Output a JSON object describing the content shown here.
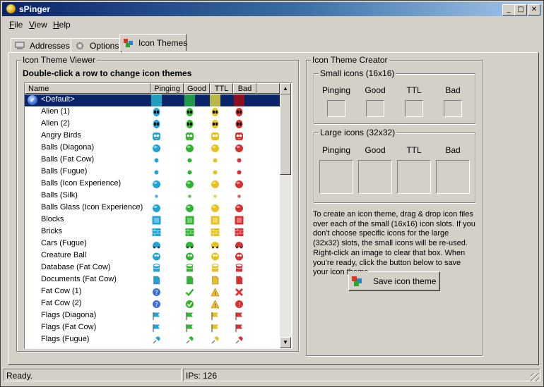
{
  "window": {
    "title": "sPinger"
  },
  "menu": [
    {
      "label": "File",
      "key": "F",
      "rest": "ile"
    },
    {
      "label": "View",
      "key": "V",
      "rest": "iew"
    },
    {
      "label": "Help",
      "key": "H",
      "rest": "elp"
    }
  ],
  "tabs": [
    {
      "label": "Addresses",
      "active": false
    },
    {
      "label": "Options",
      "active": false
    },
    {
      "label": "Icon Themes",
      "active": true
    }
  ],
  "viewer": {
    "group_title": "Icon Theme Viewer",
    "instruction": "Double-click a row to change icon themes",
    "columns": [
      "Name",
      "Pinging",
      "Good",
      "TTL",
      "Bad"
    ],
    "rows": [
      {
        "name": "<Default>",
        "selected": true,
        "icon": "default-swatch"
      },
      {
        "name": "Alien (1)",
        "icon": "alien"
      },
      {
        "name": "Alien (2)",
        "icon": "alien"
      },
      {
        "name": "Angry Birds",
        "icon": "bird"
      },
      {
        "name": "Balls (Diagona)",
        "icon": "ball-large"
      },
      {
        "name": "Balls (Fat Cow)",
        "icon": "ball-small"
      },
      {
        "name": "Balls (Fugue)",
        "icon": "ball-small"
      },
      {
        "name": "Balls (Icon Experience)",
        "icon": "ball-large"
      },
      {
        "name": "Balls (Silk)",
        "icon": "ball-tiny"
      },
      {
        "name": "Balls Glass (Icon Experience)",
        "icon": "ball-large"
      },
      {
        "name": "Blocks",
        "icon": "block"
      },
      {
        "name": "Bricks",
        "icon": "brick"
      },
      {
        "name": "Cars (Fugue)",
        "icon": "car"
      },
      {
        "name": "Creature Ball",
        "icon": "creature"
      },
      {
        "name": "Database (Fat Cow)",
        "icon": "database"
      },
      {
        "name": "Documents (Fat Cow)",
        "icon": "document"
      },
      {
        "name": "Fat Cow (1)",
        "icon": "status-1"
      },
      {
        "name": "Fat Cow (2)",
        "icon": "status-2"
      },
      {
        "name": "Flags (Diagona)",
        "icon": "flag"
      },
      {
        "name": "Flags (Fat Cow)",
        "icon": "flag"
      },
      {
        "name": "Flags (Fugue)",
        "icon": "pin"
      }
    ]
  },
  "creator": {
    "group_title": "Icon Theme Creator",
    "small_title": "Small icons (16x16)",
    "large_title": "Large icons (32x32)",
    "slot_labels": [
      "Pinging",
      "Good",
      "TTL",
      "Bad"
    ],
    "help_text": "To create an icon theme, drag & drop icon files over each of the small (16x16) icon slots.  If you don't choose specific icons for the large (32x32) slots, the small icons will be re-used.  Right-click an image to clear that box.  When you're ready, click the button below to save your icon theme.",
    "save_label": "Save icon theme"
  },
  "status": {
    "left": "Ready.",
    "right": "IPs: 126"
  },
  "colors": {
    "pinging": "#1fa3d8",
    "good": "#2fb52f",
    "ttl": "#e8c21a",
    "bad": "#d83030",
    "default_pinging": "#1e9fbf",
    "default_good": "#1f9a4a",
    "default_ttl": "#b8b84a",
    "default_bad": "#8a1020"
  }
}
